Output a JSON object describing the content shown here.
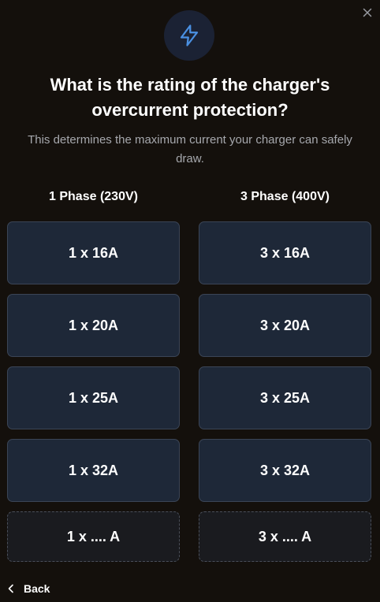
{
  "dialog": {
    "close_icon": "close-icon",
    "header_icon": "lightning-bolt-icon",
    "accent_color": "#4a90e2",
    "title": "What is the rating of the charger's overcurrent protection?",
    "subtitle": "This determines the maximum current your charger can safely draw."
  },
  "columns": {
    "single_phase": {
      "heading": "1 Phase (230V)",
      "options": [
        "1 x 16A",
        "1 x 20A",
        "1 x 25A",
        "1 x 32A"
      ],
      "custom": "1 x .... A"
    },
    "three_phase": {
      "heading": "3 Phase (400V)",
      "options": [
        "3 x 16A",
        "3 x 20A",
        "3 x 25A",
        "3 x 32A"
      ],
      "custom": "3 x .... A"
    }
  },
  "footer": {
    "back_label": "Back"
  }
}
